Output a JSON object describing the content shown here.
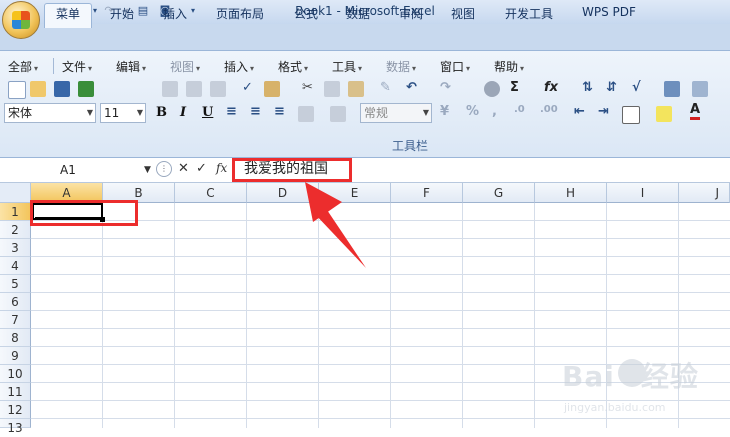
{
  "window": {
    "title": "Book1 - Microsoft Excel"
  },
  "quick_access": [
    "save-icon",
    "undo-icon",
    "redo-icon",
    "print-preview-icon",
    "camera-icon",
    "customize-icon"
  ],
  "tabs": [
    {
      "label": "菜单",
      "active": true
    },
    {
      "label": "开始"
    },
    {
      "label": "插入"
    },
    {
      "label": "页面布局"
    },
    {
      "label": "公式"
    },
    {
      "label": "数据"
    },
    {
      "label": "审阅"
    },
    {
      "label": "视图"
    },
    {
      "label": "开发工具"
    },
    {
      "label": "WPS PDF"
    }
  ],
  "menus": [
    {
      "label": "全部",
      "enabled": true
    },
    {
      "label": "文件",
      "enabled": true
    },
    {
      "label": "编辑",
      "enabled": true
    },
    {
      "label": "视图",
      "enabled": false
    },
    {
      "label": "插入",
      "enabled": true
    },
    {
      "label": "格式",
      "enabled": true
    },
    {
      "label": "工具",
      "enabled": true
    },
    {
      "label": "数据",
      "enabled": false
    },
    {
      "label": "窗口",
      "enabled": true
    },
    {
      "label": "帮助",
      "enabled": true
    }
  ],
  "font": {
    "name": "宋体",
    "size": "11"
  },
  "number_format": "常规",
  "toolbar_label": "工具栏",
  "formula_bar": {
    "name_box": "A1",
    "fx": "fx",
    "cancel": "✕",
    "enter": "✓",
    "content": "我爱我的祖国"
  },
  "columns": [
    "A",
    "B",
    "C",
    "D",
    "E",
    "F",
    "G",
    "H",
    "I",
    "J"
  ],
  "rows": [
    "1",
    "2",
    "3",
    "4",
    "5",
    "6",
    "7",
    "8",
    "9",
    "10",
    "11",
    "12",
    "13"
  ],
  "active_cell": "A1",
  "watermark": {
    "brand": "Bai",
    "brand2": "经验",
    "site": "jingyan.baidu.com"
  },
  "colors": {
    "annotation": "#ec2d2d",
    "selected_header": "#f3c55c",
    "ribbon": "#dbe7f5"
  }
}
